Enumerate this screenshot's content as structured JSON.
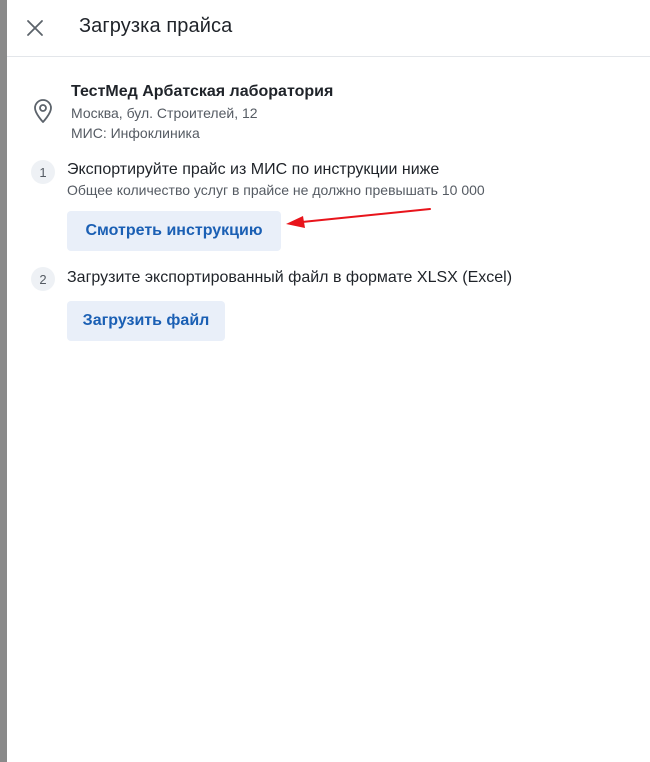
{
  "header": {
    "title": "Загрузка прайса",
    "close_icon": "close-icon"
  },
  "clinic": {
    "icon": "location-pin-icon",
    "name": "ТестМед Арбатская лаборатория",
    "address": "Москва, бул. Строителей, 12",
    "mis": "МИС: Инфоклиника"
  },
  "steps": [
    {
      "number": "1",
      "text": "Экспортируйте прайс из МИС по инструкции ниже",
      "subtext": "Общее количество услуг в прайсе не должно превышать 10 000",
      "button_label": "Смотреть инструкцию"
    },
    {
      "number": "2",
      "text": "Загрузите экспортированный файл в формате XLSX (Excel)",
      "button_label": "Загрузить файл"
    }
  ],
  "annotation": {
    "arrow_color": "#e8141b"
  },
  "colors": {
    "button_bg": "#e9eff9",
    "button_text": "#1a5fb4",
    "secondary_text": "#555b63",
    "divider": "#e3e6ea"
  }
}
